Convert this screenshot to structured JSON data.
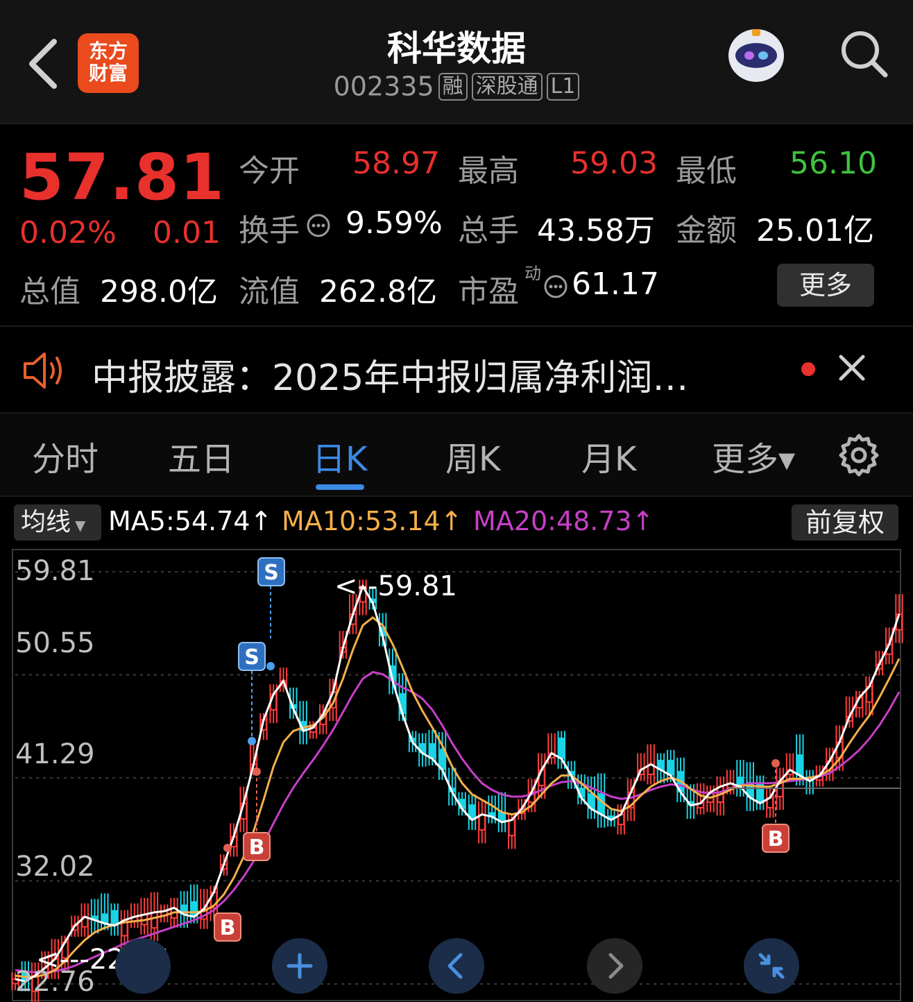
{
  "header": {
    "logo_line1": "东方",
    "logo_line2": "财富",
    "title": "科华数据",
    "code": "002335",
    "tags": [
      "融",
      "深股通",
      "L1"
    ]
  },
  "quote": {
    "price": "57.81",
    "change_pct": "0.02%",
    "change": "0.01",
    "open_label": "今开",
    "open": "58.97",
    "high_label": "最高",
    "high": "59.03",
    "low_label": "最低",
    "low": "56.10",
    "turnover_label": "换手",
    "turnover": "9.59%",
    "volume_label": "总手",
    "volume": "43.58万",
    "amount_label": "金额",
    "amount": "25.01亿",
    "total_mv_label": "总值",
    "total_mv": "298.0亿",
    "float_mv_label": "流值",
    "float_mv": "262.8亿",
    "pe_label": "市盈",
    "pe_sup": "动",
    "pe": "61.17",
    "more_button": "更多",
    "colors": {
      "up": "#e8302d",
      "down": "#3fc33f"
    }
  },
  "notice": {
    "text": "中报披露：2025年中报归属净利润…"
  },
  "tabs": [
    {
      "label": "分时"
    },
    {
      "label": "五日"
    },
    {
      "label": "日K",
      "active": true
    },
    {
      "label": "周K"
    },
    {
      "label": "月K"
    },
    {
      "label": "更多▾"
    }
  ],
  "ma_bar": {
    "select_label": "均线",
    "ma5": "MA5:54.74↑",
    "ma10": "MA10:53.14↑",
    "ma20": "MA20:48.73↑",
    "adjust_button": "前复权",
    "colors": {
      "ma5": "#ffffff",
      "ma10": "#f5b04a",
      "ma20": "#c640c6"
    }
  },
  "chart_data": {
    "type": "candlestick",
    "y_ticks": [
      "59.81",
      "50.55",
      "41.29",
      "32.02",
      "22.76"
    ],
    "ylim": [
      22.76,
      59.81
    ],
    "high_marker": "59.81",
    "low_marker": "22.76",
    "high_marker_prefix": "<--",
    "low_marker_prefix": "<---",
    "signals": [
      "S",
      "S",
      "B",
      "B",
      "B"
    ],
    "ma5": [
      23.2,
      23.0,
      23.5,
      24.2,
      25.0,
      26.5,
      28.0,
      28.8,
      28.5,
      28.2,
      28.0,
      28.5,
      28.8,
      29.0,
      29.2,
      29.3,
      29.6,
      29.0,
      28.8,
      29.5,
      31.0,
      33.5,
      36.0,
      39.0,
      42.5,
      46.5,
      48.8,
      50.0,
      47.5,
      45.5,
      45.8,
      47.0,
      49.0,
      53.0,
      56.0,
      58.5,
      57.0,
      54.0,
      50.0,
      47.0,
      44.5,
      43.5,
      43.0,
      42.0,
      40.0,
      38.5,
      37.5,
      38.0,
      37.8,
      37.3,
      37.5,
      38.5,
      40.0,
      42.0,
      43.5,
      43.0,
      41.5,
      39.5,
      38.5,
      38.0,
      37.5,
      38.0,
      40.0,
      42.0,
      42.5,
      42.0,
      41.5,
      40.0,
      38.8,
      39.0,
      40.0,
      40.5,
      40.8,
      40.5,
      39.5,
      39.0,
      39.5,
      41.0,
      42.0,
      41.5,
      41.0,
      41.5,
      42.8,
      44.5,
      46.8,
      48.5,
      49.5,
      51.5,
      53.3,
      56.0
    ],
    "ma10": [
      23.5,
      23.4,
      23.4,
      23.6,
      24.0,
      24.8,
      25.8,
      26.7,
      27.4,
      27.8,
      28.1,
      28.3,
      28.4,
      28.5,
      28.7,
      28.9,
      29.2,
      29.2,
      29.2,
      29.3,
      29.8,
      30.8,
      32.3,
      34.2,
      36.5,
      39.3,
      42.3,
      44.5,
      45.5,
      45.8,
      46.0,
      46.7,
      48.0,
      50.2,
      52.8,
      55.0,
      55.7,
      55.0,
      53.3,
      51.2,
      49.0,
      47.3,
      45.8,
      44.2,
      42.3,
      40.8,
      39.8,
      39.3,
      38.8,
      38.2,
      38.0,
      38.2,
      38.8,
      39.8,
      40.8,
      41.5,
      41.5,
      40.8,
      40.0,
      39.2,
      38.5,
      38.3,
      38.8,
      39.7,
      40.5,
      41.0,
      41.3,
      41.0,
      40.3,
      39.7,
      39.5,
      39.8,
      40.2,
      40.6,
      40.6,
      40.5,
      40.5,
      40.8,
      41.2,
      41.2,
      41.3,
      41.5,
      42.0,
      43.0,
      44.4,
      45.7,
      46.9,
      48.5,
      50.2,
      52.0
    ],
    "ma20": [
      24.0,
      23.9,
      23.8,
      23.8,
      23.9,
      24.1,
      24.4,
      24.8,
      25.2,
      25.6,
      26.0,
      26.4,
      26.7,
      27.0,
      27.3,
      27.6,
      27.9,
      28.2,
      28.5,
      28.9,
      29.4,
      30.2,
      31.2,
      32.4,
      33.8,
      35.4,
      37.2,
      38.9,
      40.4,
      41.7,
      42.9,
      44.2,
      45.6,
      47.2,
      48.8,
      50.2,
      50.8,
      50.6,
      50.0,
      49.4,
      49.0,
      48.4,
      47.4,
      46.0,
      44.4,
      43.0,
      41.8,
      40.8,
      40.2,
      39.8,
      39.6,
      39.6,
      39.8,
      40.2,
      40.6,
      40.9,
      41.0,
      40.8,
      40.4,
      40.0,
      39.6,
      39.4,
      39.5,
      39.8,
      40.2,
      40.5,
      40.7,
      40.6,
      40.3,
      40.0,
      39.9,
      40.0,
      40.3,
      40.6,
      40.8,
      40.8,
      40.8,
      40.9,
      41.0,
      41.1,
      41.2,
      41.4,
      41.7,
      42.3,
      43.0,
      43.8,
      44.8,
      46.0,
      47.4,
      49.0
    ]
  }
}
